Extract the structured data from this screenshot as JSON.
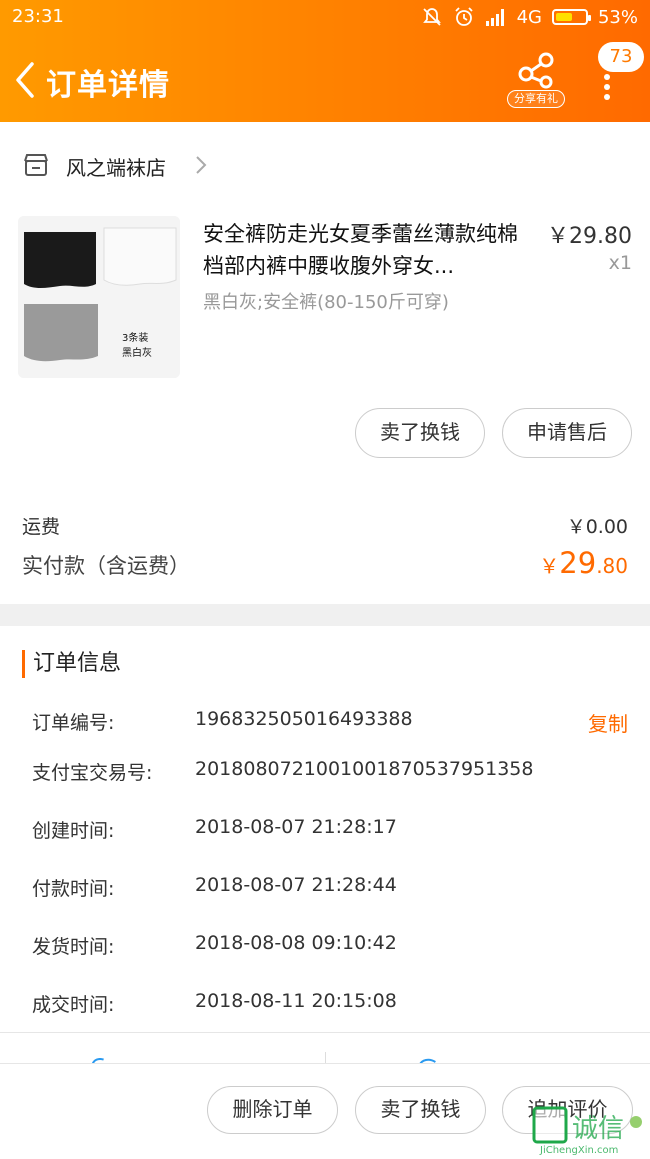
{
  "status_bar": {
    "time": "23:31",
    "network": "4G",
    "battery": "53%"
  },
  "header": {
    "title": "订单详情",
    "share_label": "分享有礼",
    "badge_count": "73",
    "accent": "#ff7a00"
  },
  "shop": {
    "name": "风之端袜店"
  },
  "product": {
    "title": "安全裤防走光女夏季蕾丝薄款纯棉档部内裤中腰收腹外穿女...",
    "sku": "黑白灰;安全裤(80-150斤可穿)",
    "price": "￥29.80",
    "qty": "x1",
    "thumb_caption_1": "3条装",
    "thumb_caption_2": "黑白灰"
  },
  "item_actions": {
    "sell_label": "卖了换钱",
    "after_sale_label": "申请售后"
  },
  "summary": {
    "shipping_label": "运费",
    "shipping_value": "￥0.00",
    "paid_label": "实付款（含运费）",
    "paid_currency": "￥",
    "paid_int": "29",
    "paid_dec": ".80"
  },
  "order_info": {
    "title": "订单信息",
    "copy_label": "复制",
    "rows": [
      {
        "label": "订单编号:",
        "value": "196832505016493388"
      },
      {
        "label": "支付宝交易号:",
        "value": "2018080721001001870537951358"
      },
      {
        "label": "创建时间:",
        "value": "2018-08-07 21:28:17"
      },
      {
        "label": "付款时间:",
        "value": "2018-08-07 21:28:44"
      },
      {
        "label": "发货时间:",
        "value": "2018-08-08 09:10:42"
      },
      {
        "label": "成交时间:",
        "value": "2018-08-11 20:15:08"
      }
    ]
  },
  "bottom_actions": {
    "delete_label": "删除订单",
    "sell_label": "卖了换钱",
    "review_label": "追加评价"
  },
  "watermark": {
    "cn": "诚信",
    "en": "JiChengXin.com"
  }
}
